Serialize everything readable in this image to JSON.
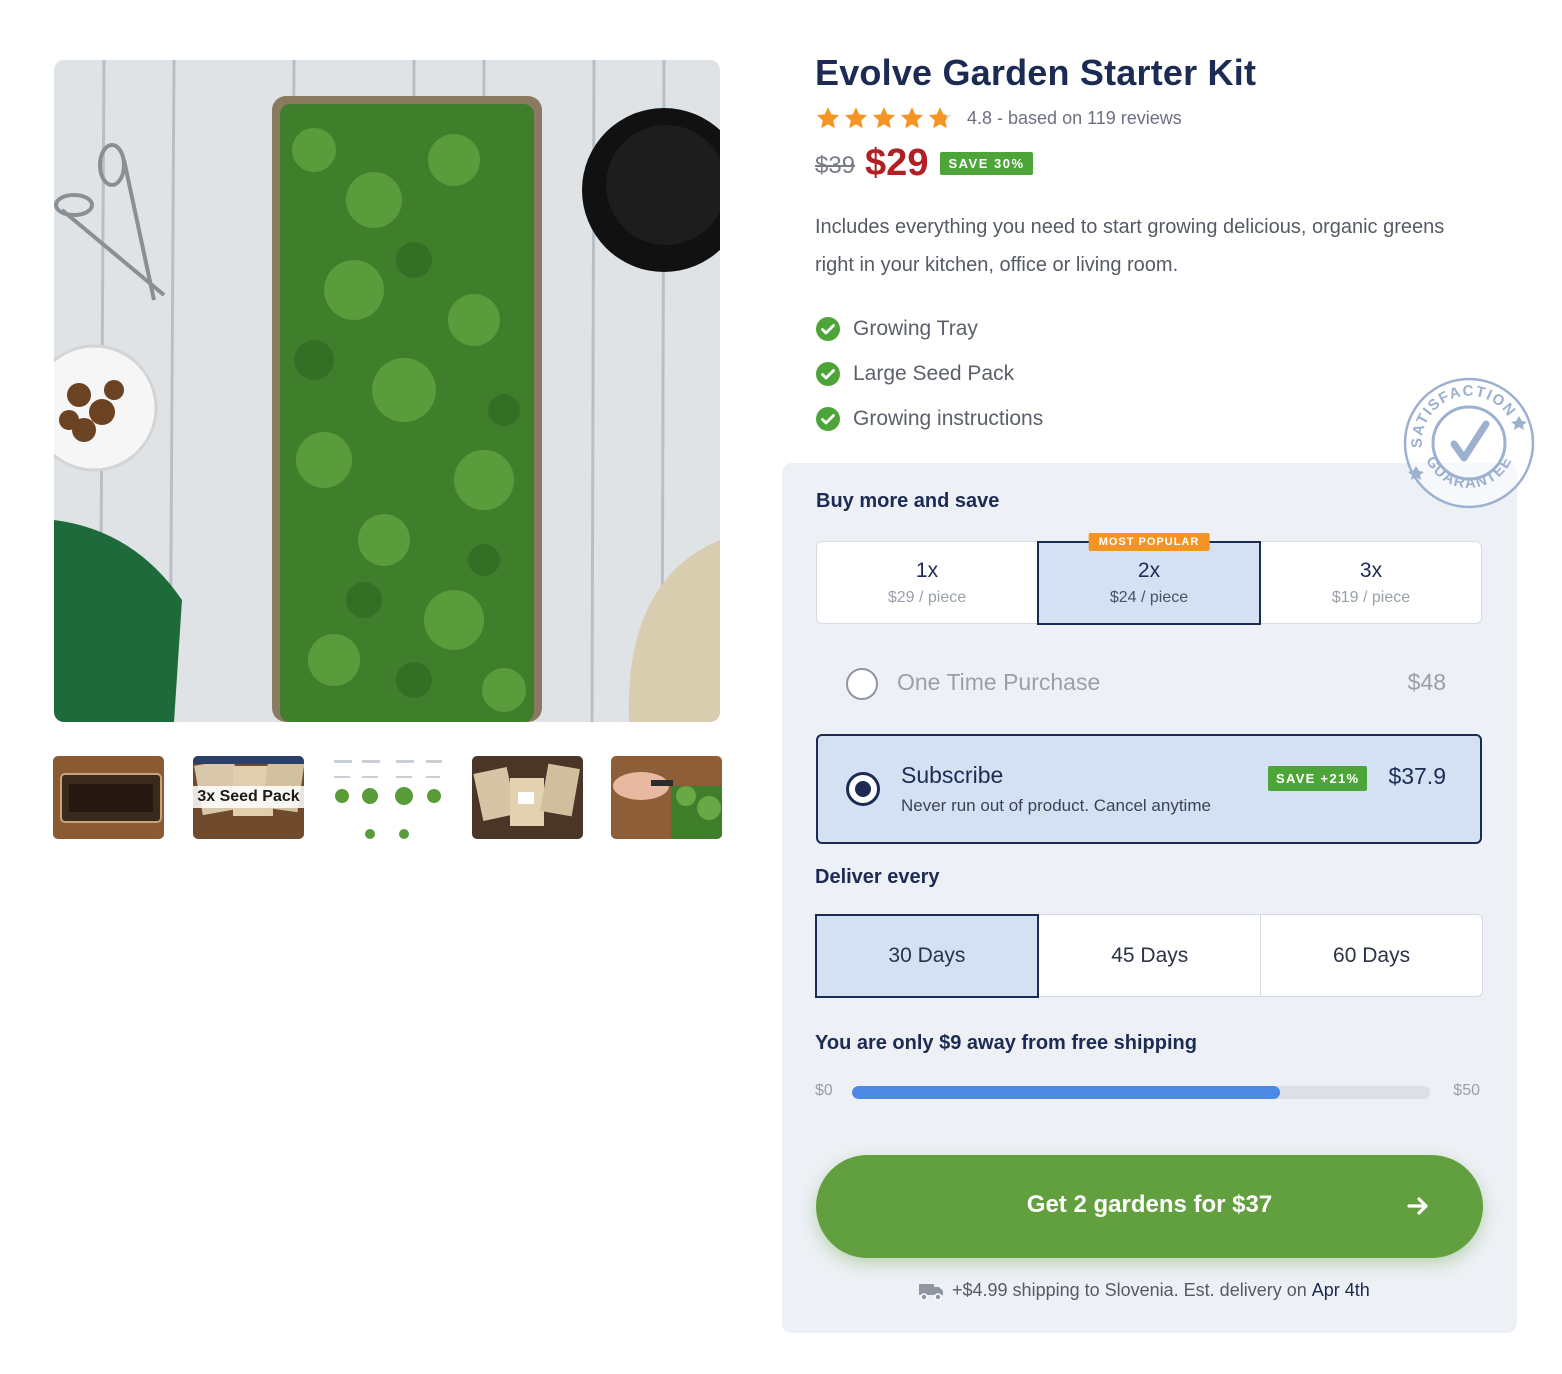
{
  "product": {
    "title": "Evolve Garden Starter Kit",
    "rating_value": 4.8,
    "rating_text": "4.8 - based on 119 reviews",
    "old_price": "$39",
    "price": "$29",
    "save_badge": "SAVE 30%",
    "description": "Includes everything you need to start growing delicious, organic greens right in your kitchen, office or living room.",
    "features": [
      "Growing Tray",
      "Large Seed Pack",
      "Growing instructions"
    ]
  },
  "gallery": {
    "thumbnails": [
      {
        "icon": "tray-photo-icon",
        "label": ""
      },
      {
        "icon": "seed-pack-photo-icon",
        "label": "3x Seed Pack"
      },
      {
        "icon": "seed-chart-photo-icon",
        "label": ""
      },
      {
        "icon": "seed-bags-photo-icon",
        "label": ""
      },
      {
        "icon": "harvest-photo-icon",
        "label": ""
      }
    ]
  },
  "guarantee_badge": {
    "top_text": "SATISFACTION",
    "bottom_text": "GUARANTEE"
  },
  "bundle": {
    "heading": "Buy more and save",
    "options": [
      {
        "count": "1x",
        "price": "$29 / piece",
        "badge": ""
      },
      {
        "count": "2x",
        "price": "$24 / piece",
        "badge": "MOST POPULAR"
      },
      {
        "count": "3x",
        "price": "$19 / piece",
        "badge": ""
      }
    ],
    "selected_index": 1
  },
  "purchase": {
    "one_time": {
      "label": "One Time Purchase",
      "price": "$48"
    },
    "subscribe": {
      "label": "Subscribe",
      "sub": "Never run out of product. Cancel anytime",
      "badge": "SAVE +21%",
      "price": "$37.9"
    },
    "selected": "subscribe"
  },
  "delivery": {
    "heading": "Deliver every",
    "options": [
      "30 Days",
      "45 Days",
      "60 Days"
    ],
    "selected_index": 0
  },
  "shipping_progress": {
    "message": "You are only $9 away from free shipping",
    "min_label": "$0",
    "max_label": "$50",
    "progress": 0.74
  },
  "cta": {
    "label": "Get 2 gardens for $37",
    "icon": "arrow-right-icon"
  },
  "shipping_note": {
    "icon": "truck-icon",
    "text": "+$4.99 shipping to Slovenia. Est. delivery on",
    "date": "Apr 4th"
  },
  "colors": {
    "brand_navy": "#1c2b53",
    "sale_red": "#b21f24",
    "save_green": "#4da53a",
    "cta_green": "#62a03f",
    "popular_orange": "#f39423",
    "progress_blue": "#4c89e4",
    "star_orange": "#f39423"
  }
}
